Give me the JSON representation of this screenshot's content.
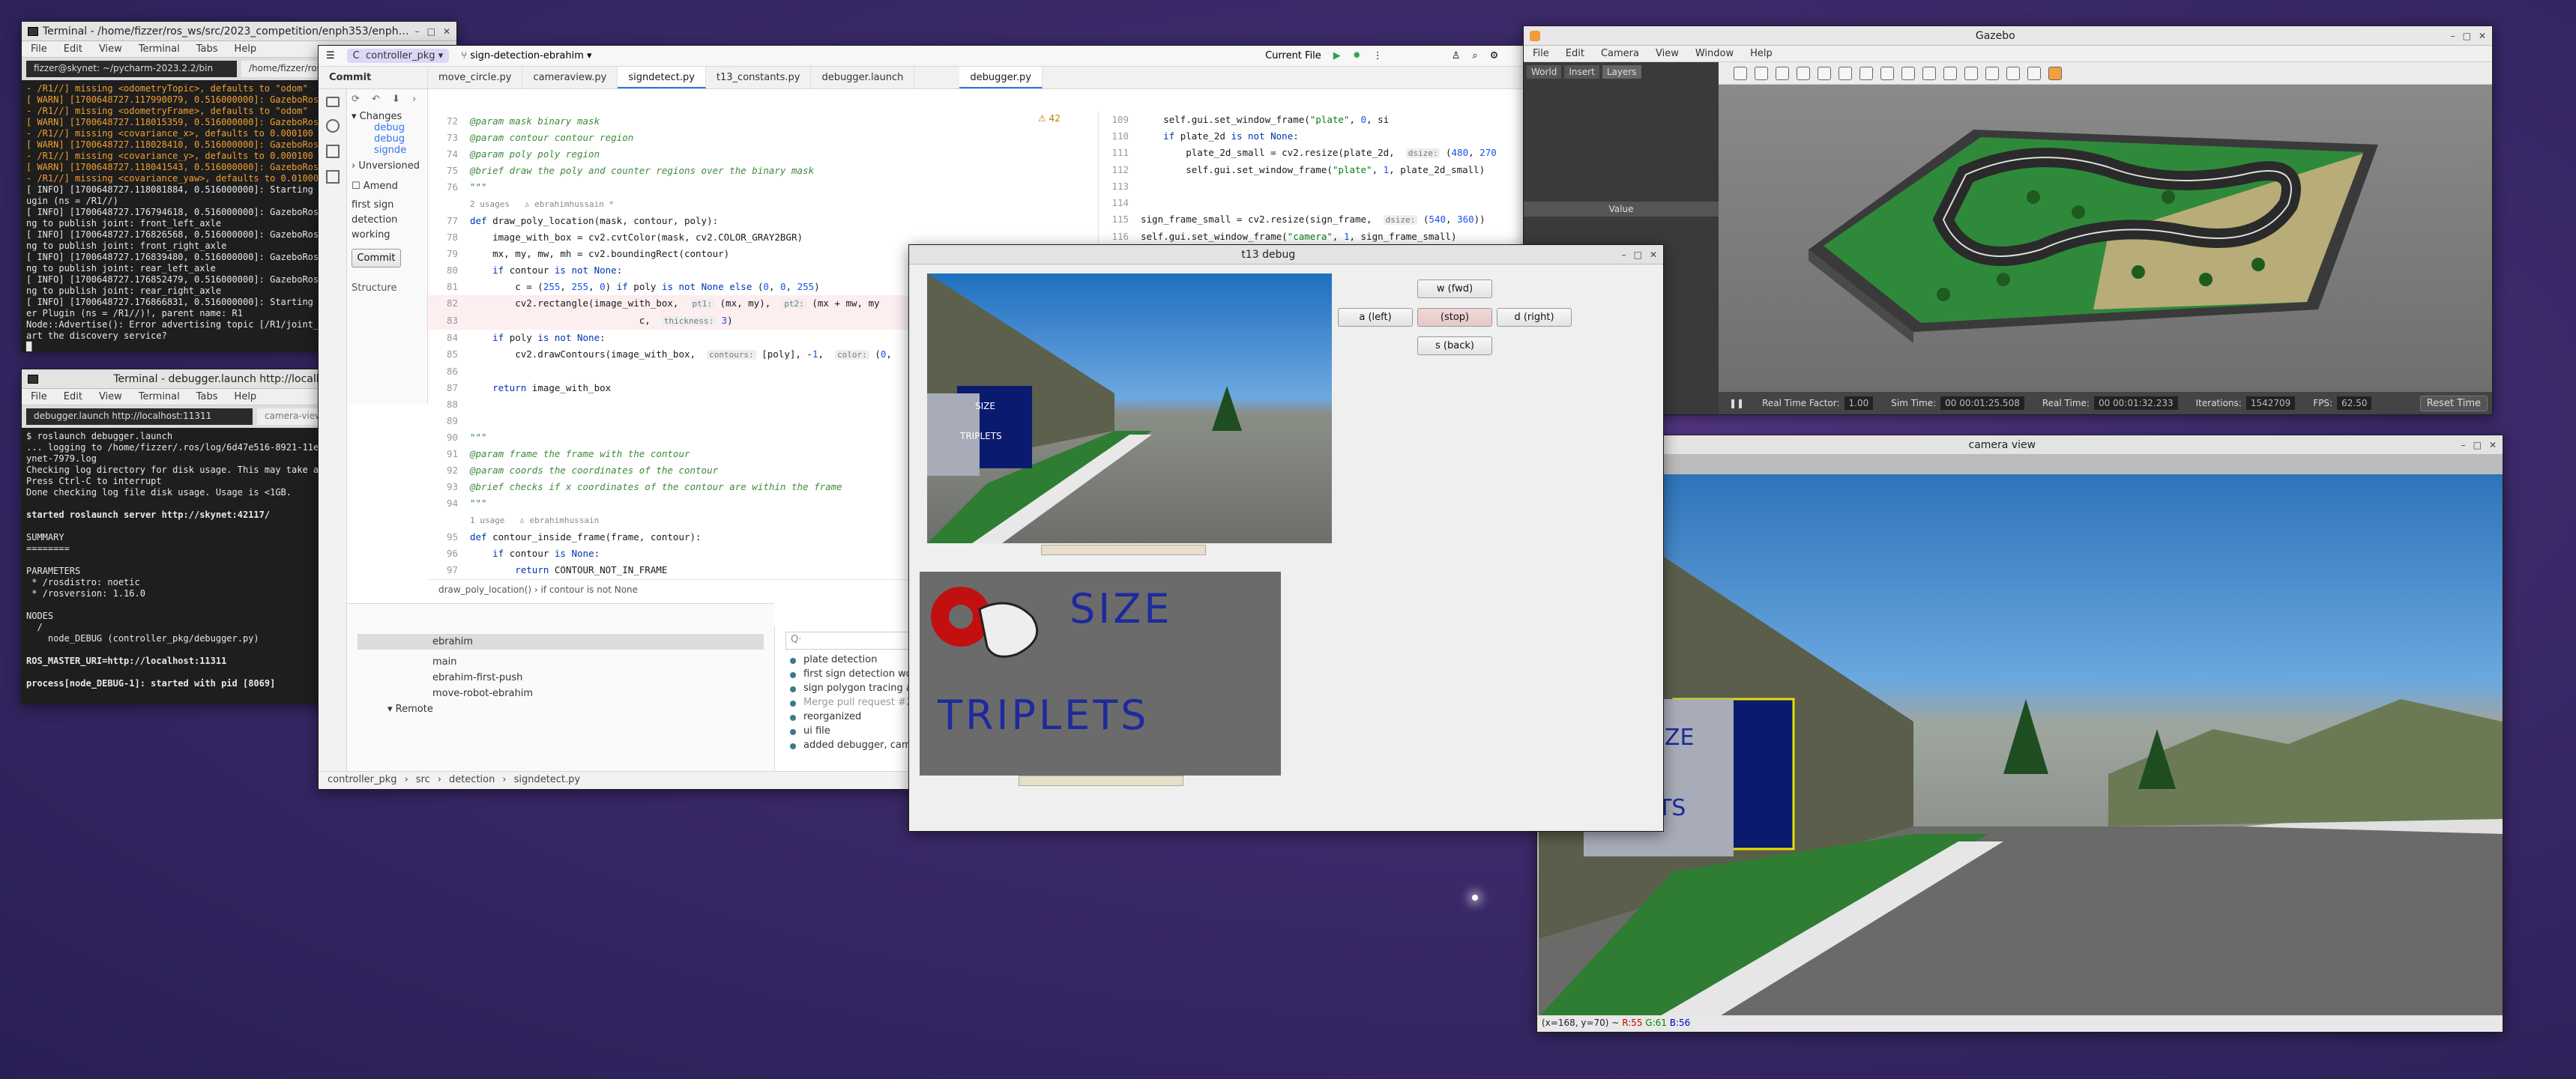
{
  "desktop": {
    "bg": "#3d2a6b"
  },
  "terminal1": {
    "title": "Terminal - /home/fizzer/ros_ws/src/2023_competition/enph353/enph353_utils/laun",
    "menu": [
      "File",
      "Edit",
      "View",
      "Terminal",
      "Tabs",
      "Help"
    ],
    "tabs": [
      "fizzer@skynet: ~/pycharm-2023.2.2/bin",
      "/home/fizzer/ros_ws/src/20"
    ],
    "lines": [
      {
        "c": "warn",
        "t": "- /R1//] missing <odometryTopic>, defaults to \"odom\""
      },
      {
        "c": "warn",
        "t": "[ WARN] [1700648727.117990079, 0.516000000]: GazeboRosSk"
      },
      {
        "c": "warn",
        "t": "- /R1//] missing <odometryFrame>, defaults to \"odom\""
      },
      {
        "c": "warn",
        "t": "[ WARN] [1700648727.118015359, 0.516000000]: GazeboRosSk"
      },
      {
        "c": "warn",
        "t": "- /R1//] missing <covariance_x>, defaults to 0.000100"
      },
      {
        "c": "warn",
        "t": "[ WARN] [1700648727.118028410, 0.516000000]: GazeboRosSk"
      },
      {
        "c": "warn",
        "t": "- /R1//] missing <covariance_y>, defaults to 0.000100"
      },
      {
        "c": "warn",
        "t": "[ WARN] [1700648727.118041543, 0.516000000]: GazeboRosSk"
      },
      {
        "c": "warn",
        "t": "- /R1//] missing <covariance_yaw>, defaults to 0.010000"
      },
      {
        "c": "info",
        "t": "[ INFO] [1700648727.118081884, 0.516000000]: Starting Gaz"
      },
      {
        "c": "info",
        "t": "ugin (ns = /R1//)"
      },
      {
        "c": "info",
        "t": "[ INFO] [1700648727.176794618, 0.516000000]: GazeboRosJoi"
      },
      {
        "c": "info",
        "t": "ng to publish joint: front_left_axle"
      },
      {
        "c": "info",
        "t": "[ INFO] [1700648727.176826568, 0.516000000]: GazeboRosJoi"
      },
      {
        "c": "info",
        "t": "ng to publish joint: front_right_axle"
      },
      {
        "c": "info",
        "t": "[ INFO] [1700648727.176839480, 0.516000000]: GazeboRosJoi"
      },
      {
        "c": "info",
        "t": "ng to publish joint: rear_left_axle"
      },
      {
        "c": "info",
        "t": "[ INFO] [1700648727.176852479, 0.516000000]: GazeboRosJoi"
      },
      {
        "c": "info",
        "t": "ng to publish joint: rear_right_axle"
      },
      {
        "c": "info",
        "t": "[ INFO] [1700648727.176866831, 0.516000000]: Starting Gaz"
      },
      {
        "c": "info",
        "t": "er Plugin (ns = /R1//)!, parent name: R1"
      },
      {
        "c": "info",
        "t": "Node::Advertise(): Error advertising topic [/R1/joint_cmd"
      },
      {
        "c": "info",
        "t": "art the discovery service?"
      },
      {
        "c": "info",
        "t": "█"
      }
    ]
  },
  "terminal2": {
    "title": "Terminal - debugger.launch http://localhost:11311",
    "menu": [
      "File",
      "Edit",
      "View",
      "Terminal",
      "Tabs",
      "Help"
    ],
    "tabs": [
      "debugger.launch http://localhost:11311",
      "camera-view.launch http://localhost:11311"
    ],
    "lines": [
      {
        "b": false,
        "t": "$ roslaunch debugger.launch"
      },
      {
        "b": false,
        "t": "... logging to /home/fizzer/.ros/log/6d47e516-8921-11ee-95d3-7d56e1ea334c/roslaunch-sk"
      },
      {
        "b": false,
        "t": "ynet-7979.log"
      },
      {
        "b": false,
        "t": "Checking log directory for disk usage. This may take a while."
      },
      {
        "b": false,
        "t": "Press Ctrl-C to interrupt"
      },
      {
        "b": false,
        "t": "Done checking log file disk usage. Usage is <1GB."
      },
      {
        "b": false,
        "t": ""
      },
      {
        "b": true,
        "t": "started roslaunch server http://skynet:42117/"
      },
      {
        "b": false,
        "t": ""
      },
      {
        "b": false,
        "t": "SUMMARY"
      },
      {
        "b": false,
        "t": "========"
      },
      {
        "b": false,
        "t": ""
      },
      {
        "b": false,
        "t": "PARAMETERS"
      },
      {
        "b": false,
        "t": " * /rosdistro: noetic"
      },
      {
        "b": false,
        "t": " * /rosversion: 1.16.0"
      },
      {
        "b": false,
        "t": ""
      },
      {
        "b": false,
        "t": "NODES"
      },
      {
        "b": false,
        "t": "  /"
      },
      {
        "b": false,
        "t": "    node_DEBUG (controller_pkg/debugger.py)"
      },
      {
        "b": false,
        "t": ""
      },
      {
        "b": true,
        "t": "ROS_MASTER_URI=http://localhost:11311"
      },
      {
        "b": false,
        "t": ""
      },
      {
        "b": true,
        "t": "process[node_DEBUG-1]: started with pid [8069]"
      }
    ]
  },
  "ide": {
    "project": "controller_pkg",
    "branch": "sign-detection-ebrahim",
    "run_config": "Current File",
    "commit_tab": "Commit",
    "tabs": [
      "move_circle.py",
      "cameraview.py",
      "signdetect.py",
      "t13_constants.py",
      "debugger.launch"
    ],
    "right_tab": "debugger.py",
    "changes_label": "Changes",
    "change_files": [
      "debug",
      "debug",
      "signde"
    ],
    "unversioned_label": "Unversioned",
    "amend_label": "Amend",
    "commit_msg": [
      "first sign",
      "detection",
      "working"
    ],
    "commit_button": "Commit",
    "structure_label": "Structure",
    "warnings": "⚠ 42",
    "code_lines": [
      {
        "n": "72",
        "h": "<span class='cm'>@param mask binary mask</span>"
      },
      {
        "n": "73",
        "h": "<span class='cm'>@param contour contour region</span>"
      },
      {
        "n": "74",
        "h": "<span class='cm'>@param poly poly region</span>"
      },
      {
        "n": "75",
        "h": "<span class='cm'>@brief draw the poly and counter regions over the binary mask</span>"
      },
      {
        "n": "76",
        "h": "<span class='cm'>\"\"\"</span>"
      },
      {
        "n": "",
        "h": "<span style='color:#888;font-size:11px'>2 usages   ♙ ebrahimhussain *</span>"
      },
      {
        "n": "77",
        "h": "<span class='kw'>def</span> draw_poly_location(mask, contour, poly):"
      },
      {
        "n": "78",
        "h": "    image_with_box = cv2.cvtColor(mask, cv2.COLOR_GRAY2BGR)"
      },
      {
        "n": "79",
        "h": "    mx, my, mw, mh = cv2.boundingRect(contour)"
      },
      {
        "n": "80",
        "h": "    <span class='kw'>if</span> contour <span class='kw'>is not None</span>:"
      },
      {
        "n": "81",
        "h": "        c = (<span class='num'>255</span>, <span class='num'>255</span>, <span class='num'>0</span>) <span class='kw'>if</span> poly <span class='kw'>is not None else</span> (<span class='num'>0</span>, <span class='num'>0</span>, <span class='num'>255</span>)"
      },
      {
        "n": "82",
        "h": "        cv2.rectangle(image_with_box,  <span class='hint'>pt1:</span> (mx, my),  <span class='hint'>pt2:</span> (mx + mw, my"
      },
      {
        "n": "83",
        "h": "                              c,  <span class='hint'>thickness:</span> <span class='num'>3</span>)"
      },
      {
        "n": "84",
        "h": "    <span class='kw'>if</span> poly <span class='kw'>is not None</span>:"
      },
      {
        "n": "85",
        "h": "        cv2.drawContours(image_with_box,  <span class='hint'>contours:</span> [poly], -<span class='num'>1</span>,  <span class='hint'>color:</span> (<span class='num'>0</span>,"
      },
      {
        "n": "86",
        "h": ""
      },
      {
        "n": "87",
        "h": "    <span class='kw'>return</span> image_with_box"
      },
      {
        "n": "88",
        "h": ""
      },
      {
        "n": "89",
        "h": ""
      },
      {
        "n": "90",
        "h": "<span class='cm'>\"\"\"</span>"
      },
      {
        "n": "91",
        "h": "<span class='cm'>@param frame the frame with the contour</span>"
      },
      {
        "n": "92",
        "h": "<span class='cm'>@param coords the coordinates of the contour</span>"
      },
      {
        "n": "93",
        "h": "<span class='cm'>@brief checks if x coordinates of the contour are within the frame</span>"
      },
      {
        "n": "94",
        "h": "<span class='cm'>\"\"\"</span>"
      },
      {
        "n": "",
        "h": "<span style='color:#888;font-size:11px'>1 usage   ♙ ebrahimhussain</span>"
      },
      {
        "n": "95",
        "h": "<span class='kw'>def</span> contour_inside_frame(frame, contour):"
      },
      {
        "n": "96",
        "h": "    <span class='kw'>if</span> contour <span class='kw'>is</span> <span class='kw'>None</span>:"
      },
      {
        "n": "97",
        "h": "        <span class='kw'>return</span> CONTOUR_NOT_IN_FRAME"
      }
    ],
    "right_code": [
      {
        "n": "109",
        "h": "    self.gui.set_window_frame(<span class='str'>\"plate\"</span>, <span class='num'>0</span>, si"
      },
      {
        "n": "110",
        "h": "    <span class='kw'>if</span> plate_2d <span class='kw'>is not None</span>:"
      },
      {
        "n": "111",
        "h": "        plate_2d_small = cv2.resize(plate_2d,  <span class='hint'>dsize:</span> (<span class='num'>480</span>, <span class='num'>270</span>"
      },
      {
        "n": "112",
        "h": "        self.gui.set_window_frame(<span class='str'>\"plate\"</span>, <span class='num'>1</span>, plate_2d_small)"
      },
      {
        "n": "113",
        "h": ""
      },
      {
        "n": "114",
        "h": ""
      },
      {
        "n": "115",
        "h": "sign_frame_small = cv2.resize(sign_frame,  <span class='hint'>dsize:</span> (<span class='num'>540</span>, <span class='num'>360</span>))"
      },
      {
        "n": "116",
        "h": "self.gui.set_window_frame(<span class='str'>\"camera\"</span>, <span class='num'>1</span>, sign_frame_small)"
      },
      {
        "n": "117",
        "h": ""
      }
    ],
    "breadcrumb_code": [
      "draw_poly_location()",
      "if contour is not None"
    ],
    "git_branch_local": "ebrahim",
    "git_branches": [
      "main",
      "ebrahim-first-push",
      "move-robot-ebrahim"
    ],
    "remote_label": "Remote",
    "git_log": [
      "plate detection",
      "first sign detection working",
      "sign polygon tracing added",
      "Merge pull request #2 from no",
      "reorganized",
      "ui file",
      "added debugger, camera view"
    ],
    "log_search_placeholder": "Q·",
    "statusbar": [
      "controller_pkg",
      "src",
      "detection",
      "signdetect.py"
    ]
  },
  "debug": {
    "title": "t13 debug",
    "buttons": {
      "fwd": "w (fwd)",
      "left": "a (left)",
      "stop": "(stop)",
      "right": "d (right)",
      "back": "s (back)"
    },
    "sign_top": "SIZE",
    "sign_bottom": "TRIPLETS"
  },
  "gazebo": {
    "title": "Gazebo",
    "menu": [
      "File",
      "Edit",
      "Camera",
      "View",
      "Window",
      "Help"
    ],
    "panel_tabs": [
      "World",
      "Insert",
      "Layers"
    ],
    "panel_value": "Value",
    "labels": {
      "rtf": "Real Time Factor:",
      "sim": "Sim Time:",
      "real": "Real Time:",
      "iter": "Iterations:",
      "fps": "FPS:"
    },
    "values": {
      "rtf": "1.00",
      "sim": "00 00:01:25.508",
      "real": "00 00:01:32.233",
      "iter": "1542709",
      "fps": "62.50"
    },
    "reset": "Reset Time"
  },
  "camera": {
    "title": "camera view",
    "sign_top": "SIZE",
    "sign_bottom": "ETS",
    "coords": "(x=168, y=70) ~",
    "r": "R:55",
    "g": "G:61",
    "b": "B:56"
  }
}
